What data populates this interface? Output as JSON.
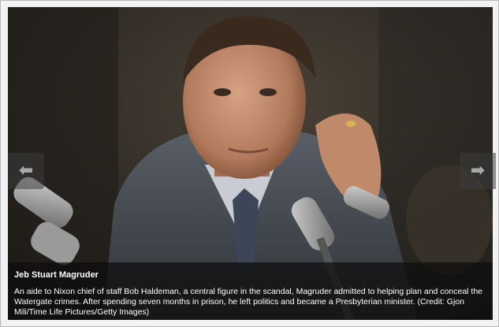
{
  "slide": {
    "image_alt": "Jeb Stuart Magruder testifying before microphones",
    "title": "Jeb Stuart Magruder",
    "caption": "An aide to Nixon chief of staff Bob Haldeman, a central figure in the scandal, Magruder admitted to helping plan and conceal the Watergate crimes. After spending seven months in prison, he left politics and became a Presbyterian minister. (Credit: Gjon Mili/Time Life Pictures/Getty Images)"
  },
  "nav": {
    "prev_icon": "arrow-left-icon",
    "prev_glyph": "⬅",
    "next_icon": "arrow-right-icon",
    "next_glyph": "➡"
  },
  "colors": {
    "caption_bg": "#0c0c0c",
    "caption_text": "#ffffff",
    "nav_bg": "#3c3c3c",
    "nav_arrow": "#a8a8a8"
  }
}
